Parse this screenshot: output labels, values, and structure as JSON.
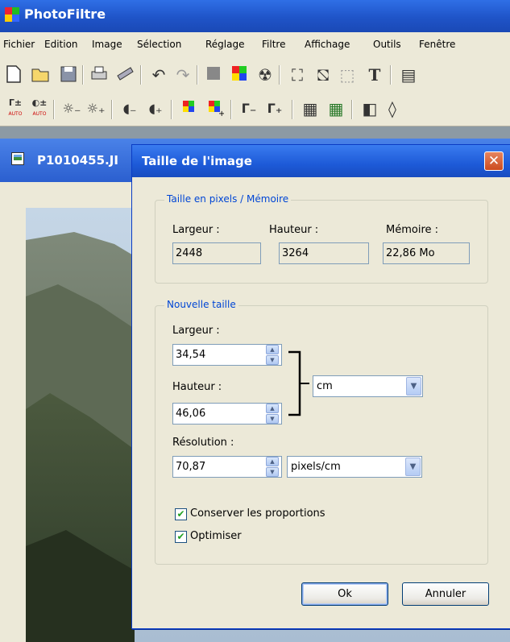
{
  "app": {
    "title": "PhotoFiltre",
    "logo_icon": "photofiltre-logo-icon"
  },
  "menu": [
    "Fichier",
    "Edition",
    "Image",
    "Sélection",
    "Réglage",
    "Filtre",
    "Affichage",
    "Outils",
    "Fenêtre"
  ],
  "toolbar1_icons": [
    "new-file-icon",
    "open-folder-icon",
    "save-icon",
    "print-icon",
    "scanner-icon",
    "undo-icon",
    "redo-icon",
    "gray-square-icon",
    "color-palette-icon",
    "radiation-icon",
    "transform-icon",
    "crop-icon",
    "selection-icon",
    "text-icon",
    "image-icon"
  ],
  "toolbar2_icons": [
    "auto-levels-icon",
    "auto-contrast-icon",
    "brightness-minus-icon",
    "brightness-plus-icon",
    "contrast-minus-icon",
    "contrast-plus-icon",
    "saturation-minus-icon",
    "saturation-plus-icon",
    "gamma-minus-icon",
    "gamma-plus-icon",
    "grid-icon",
    "grid-color-icon",
    "mirror-icon",
    "drop-icon"
  ],
  "toolbar2_labels": {
    "auto1": "Γ±",
    "auto2": "AUTO",
    "gamma_minus": "Γ_",
    "gamma_plus": "Γ₊"
  },
  "document": {
    "title": "P1010455.JI"
  },
  "dialog": {
    "title": "Taille de l'image",
    "close_icon": "close-icon",
    "group_pixels": {
      "legend": "Taille en pixels / Mémoire",
      "width_label": "Largeur :",
      "width_value": "2448",
      "height_label": "Hauteur :",
      "height_value": "3264",
      "memory_label": "Mémoire :",
      "memory_value": "22,86 Mo"
    },
    "group_new": {
      "legend": "Nouvelle taille",
      "width_label": "Largeur :",
      "width_value": "34,54",
      "height_label": "Hauteur :",
      "height_value": "46,06",
      "unit_value": "cm",
      "resolution_label": "Résolution :",
      "resolution_value": "70,87",
      "resolution_unit": "pixels/cm",
      "keep_proportions": {
        "label": "Conserver les proportions",
        "checked": true
      },
      "optimize": {
        "label": "Optimiser",
        "checked": true
      }
    },
    "ok_label": "Ok",
    "cancel_label": "Annuler"
  }
}
